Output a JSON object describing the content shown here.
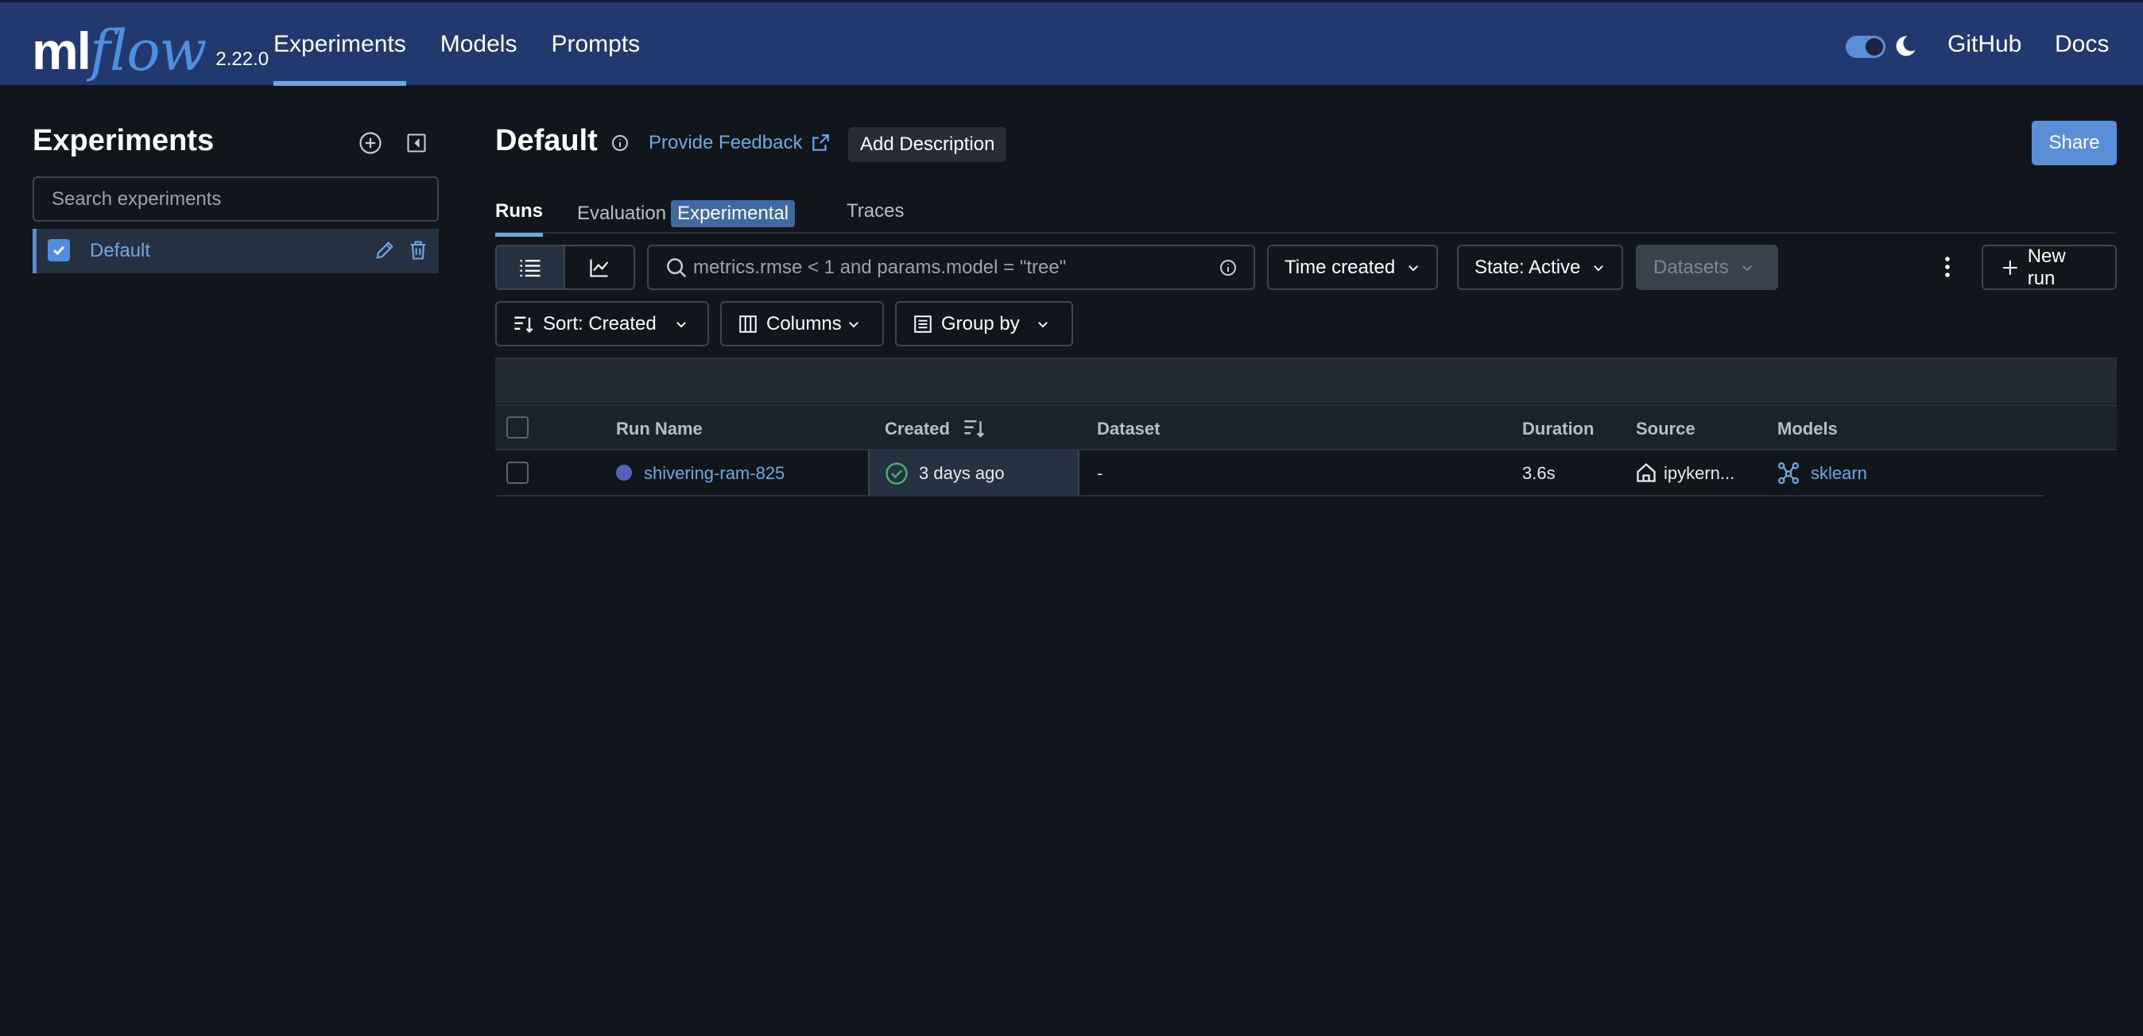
{
  "header": {
    "logo_ml": "ml",
    "logo_flow": "flow",
    "version": "2.22.0",
    "nav": [
      "Experiments",
      "Models",
      "Prompts"
    ],
    "active_nav": "Experiments",
    "links": [
      "GitHub",
      "Docs"
    ]
  },
  "sidebar": {
    "title": "Experiments",
    "search_placeholder": "Search experiments",
    "experiments": [
      {
        "name": "Default",
        "checked": true
      }
    ]
  },
  "experiment": {
    "title": "Default",
    "feedback_label": "Provide Feedback",
    "add_description_label": "Add Description",
    "share_label": "Share"
  },
  "tabs": {
    "runs": "Runs",
    "evaluation": "Evaluation",
    "evaluation_badge": "Experimental",
    "traces": "Traces",
    "active": "Runs"
  },
  "controls": {
    "filter_placeholder": "metrics.rmse < 1 and params.model = \"tree\"",
    "time_created": "Time created",
    "state": "State: Active",
    "datasets": "Datasets",
    "new_run": "New run",
    "sort": "Sort: Created",
    "columns": "Columns",
    "group_by": "Group by"
  },
  "table": {
    "columns": [
      "Run Name",
      "Created",
      "Dataset",
      "Duration",
      "Source",
      "Models"
    ],
    "rows": [
      {
        "run_name": "shivering-ram-825",
        "created": "3 days ago",
        "dataset": "-",
        "duration": "3.6s",
        "source": "ipykern...",
        "models": "sklearn"
      }
    ]
  },
  "colors": {
    "topbar": "#21396f",
    "accent": "#4f8fdd",
    "link": "#6fa8e0",
    "background": "#11161d",
    "success": "#4caf6e",
    "run_dot": "#5463b8"
  }
}
